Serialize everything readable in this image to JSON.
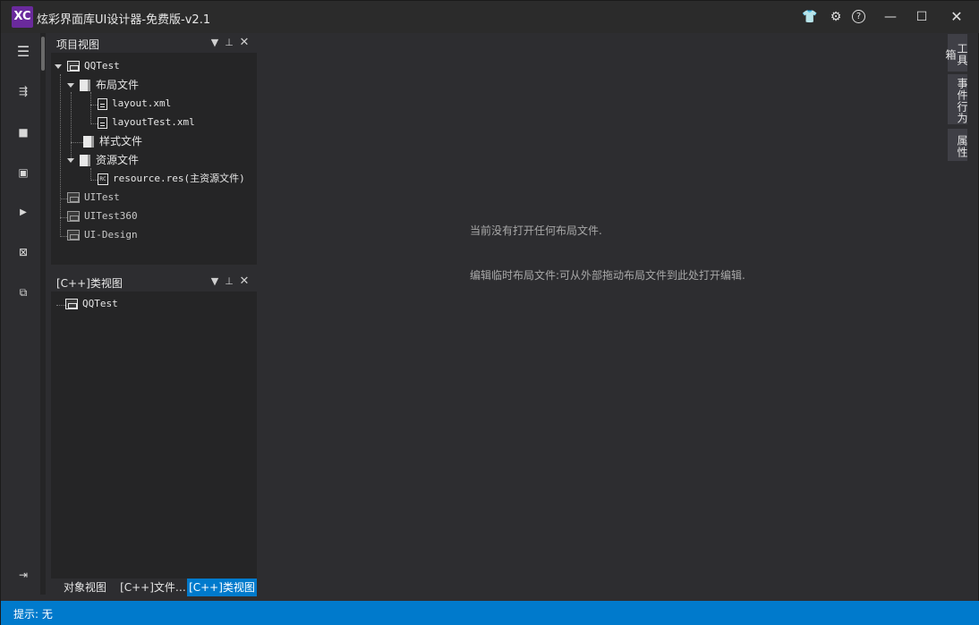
{
  "window": {
    "title": "炫彩界面库UI设计器-免费版-v2.1",
    "logo_text": "XC"
  },
  "title_bar_buttons": [
    {
      "name": "skin-icon",
      "glyph": "👕"
    },
    {
      "name": "settings-icon",
      "glyph": "⚙"
    },
    {
      "name": "help-icon",
      "glyph": "?"
    },
    {
      "name": "minimize-icon",
      "glyph": "—"
    },
    {
      "name": "maximize-icon",
      "glyph": "☐"
    },
    {
      "name": "close-icon",
      "glyph": "✕"
    }
  ],
  "left_toolbar": [
    {
      "name": "menu-icon",
      "glyph": "☰"
    },
    {
      "name": "new-file-icon",
      "glyph": "⇶"
    },
    {
      "name": "save-icon",
      "glyph": "■"
    },
    {
      "name": "save-all-icon",
      "glyph": "▣"
    },
    {
      "name": "run-preview-icon",
      "glyph": "▶"
    },
    {
      "name": "resource-icon",
      "glyph": "⊠"
    },
    {
      "name": "export-icon",
      "glyph": "⧉"
    },
    {
      "name": "collapse-panel-icon",
      "glyph": "⇥"
    }
  ],
  "project_panel": {
    "title": "项目视图",
    "tree": {
      "project": "QQTest",
      "layout_folder": "布局文件",
      "layout_files": [
        "layout.xml",
        "layoutTest.xml"
      ],
      "style_folder": "样式文件",
      "resource_folder": "资源文件",
      "resource_file": "resource.res(主资源文件)",
      "other_projects": [
        "UITest",
        "UITest360",
        "UI-Design"
      ]
    }
  },
  "class_panel": {
    "title": "[C++]类视图",
    "items": [
      "QQTest"
    ]
  },
  "bottom_tabs": [
    {
      "label": "对象视图",
      "active": false
    },
    {
      "label": "[C++]文件…",
      "active": false
    },
    {
      "label": "[C++]类视图",
      "active": true
    }
  ],
  "editor": {
    "no_file_message": "当前没有打开任何布局文件.",
    "hint_message": "编辑临时布局文件:可从外部拖动布局文件到此处打开编辑."
  },
  "right_tabs": [
    "工具箱",
    "事件行为",
    "属性"
  ],
  "status": {
    "text": "提示: 无"
  },
  "colors": {
    "accent": "#007acc",
    "background": "#2d2d30",
    "panel": "#252526"
  }
}
